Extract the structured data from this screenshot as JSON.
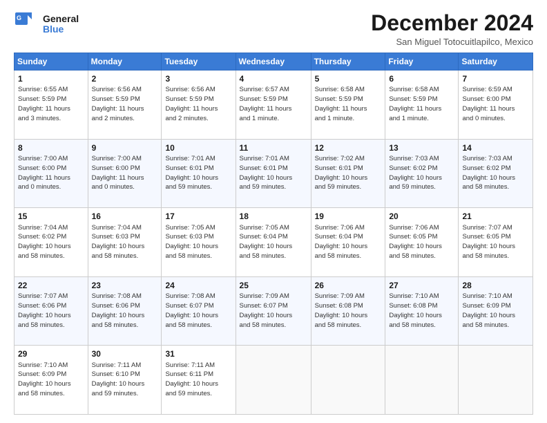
{
  "logo": {
    "line1": "General",
    "line2": "Blue"
  },
  "title": "December 2024",
  "location": "San Miguel Totocuitlapilco, Mexico",
  "days_of_week": [
    "Sunday",
    "Monday",
    "Tuesday",
    "Wednesday",
    "Thursday",
    "Friday",
    "Saturday"
  ],
  "weeks": [
    [
      {
        "day": "1",
        "info": "Sunrise: 6:55 AM\nSunset: 5:59 PM\nDaylight: 11 hours\nand 3 minutes."
      },
      {
        "day": "2",
        "info": "Sunrise: 6:56 AM\nSunset: 5:59 PM\nDaylight: 11 hours\nand 2 minutes."
      },
      {
        "day": "3",
        "info": "Sunrise: 6:56 AM\nSunset: 5:59 PM\nDaylight: 11 hours\nand 2 minutes."
      },
      {
        "day": "4",
        "info": "Sunrise: 6:57 AM\nSunset: 5:59 PM\nDaylight: 11 hours\nand 1 minute."
      },
      {
        "day": "5",
        "info": "Sunrise: 6:58 AM\nSunset: 5:59 PM\nDaylight: 11 hours\nand 1 minute."
      },
      {
        "day": "6",
        "info": "Sunrise: 6:58 AM\nSunset: 5:59 PM\nDaylight: 11 hours\nand 1 minute."
      },
      {
        "day": "7",
        "info": "Sunrise: 6:59 AM\nSunset: 6:00 PM\nDaylight: 11 hours\nand 0 minutes."
      }
    ],
    [
      {
        "day": "8",
        "info": "Sunrise: 7:00 AM\nSunset: 6:00 PM\nDaylight: 11 hours\nand 0 minutes."
      },
      {
        "day": "9",
        "info": "Sunrise: 7:00 AM\nSunset: 6:00 PM\nDaylight: 11 hours\nand 0 minutes."
      },
      {
        "day": "10",
        "info": "Sunrise: 7:01 AM\nSunset: 6:01 PM\nDaylight: 10 hours\nand 59 minutes."
      },
      {
        "day": "11",
        "info": "Sunrise: 7:01 AM\nSunset: 6:01 PM\nDaylight: 10 hours\nand 59 minutes."
      },
      {
        "day": "12",
        "info": "Sunrise: 7:02 AM\nSunset: 6:01 PM\nDaylight: 10 hours\nand 59 minutes."
      },
      {
        "day": "13",
        "info": "Sunrise: 7:03 AM\nSunset: 6:02 PM\nDaylight: 10 hours\nand 59 minutes."
      },
      {
        "day": "14",
        "info": "Sunrise: 7:03 AM\nSunset: 6:02 PM\nDaylight: 10 hours\nand 58 minutes."
      }
    ],
    [
      {
        "day": "15",
        "info": "Sunrise: 7:04 AM\nSunset: 6:02 PM\nDaylight: 10 hours\nand 58 minutes."
      },
      {
        "day": "16",
        "info": "Sunrise: 7:04 AM\nSunset: 6:03 PM\nDaylight: 10 hours\nand 58 minutes."
      },
      {
        "day": "17",
        "info": "Sunrise: 7:05 AM\nSunset: 6:03 PM\nDaylight: 10 hours\nand 58 minutes."
      },
      {
        "day": "18",
        "info": "Sunrise: 7:05 AM\nSunset: 6:04 PM\nDaylight: 10 hours\nand 58 minutes."
      },
      {
        "day": "19",
        "info": "Sunrise: 7:06 AM\nSunset: 6:04 PM\nDaylight: 10 hours\nand 58 minutes."
      },
      {
        "day": "20",
        "info": "Sunrise: 7:06 AM\nSunset: 6:05 PM\nDaylight: 10 hours\nand 58 minutes."
      },
      {
        "day": "21",
        "info": "Sunrise: 7:07 AM\nSunset: 6:05 PM\nDaylight: 10 hours\nand 58 minutes."
      }
    ],
    [
      {
        "day": "22",
        "info": "Sunrise: 7:07 AM\nSunset: 6:06 PM\nDaylight: 10 hours\nand 58 minutes."
      },
      {
        "day": "23",
        "info": "Sunrise: 7:08 AM\nSunset: 6:06 PM\nDaylight: 10 hours\nand 58 minutes."
      },
      {
        "day": "24",
        "info": "Sunrise: 7:08 AM\nSunset: 6:07 PM\nDaylight: 10 hours\nand 58 minutes."
      },
      {
        "day": "25",
        "info": "Sunrise: 7:09 AM\nSunset: 6:07 PM\nDaylight: 10 hours\nand 58 minutes."
      },
      {
        "day": "26",
        "info": "Sunrise: 7:09 AM\nSunset: 6:08 PM\nDaylight: 10 hours\nand 58 minutes."
      },
      {
        "day": "27",
        "info": "Sunrise: 7:10 AM\nSunset: 6:08 PM\nDaylight: 10 hours\nand 58 minutes."
      },
      {
        "day": "28",
        "info": "Sunrise: 7:10 AM\nSunset: 6:09 PM\nDaylight: 10 hours\nand 58 minutes."
      }
    ],
    [
      {
        "day": "29",
        "info": "Sunrise: 7:10 AM\nSunset: 6:09 PM\nDaylight: 10 hours\nand 58 minutes."
      },
      {
        "day": "30",
        "info": "Sunrise: 7:11 AM\nSunset: 6:10 PM\nDaylight: 10 hours\nand 59 minutes."
      },
      {
        "day": "31",
        "info": "Sunrise: 7:11 AM\nSunset: 6:11 PM\nDaylight: 10 hours\nand 59 minutes."
      },
      null,
      null,
      null,
      null
    ]
  ]
}
